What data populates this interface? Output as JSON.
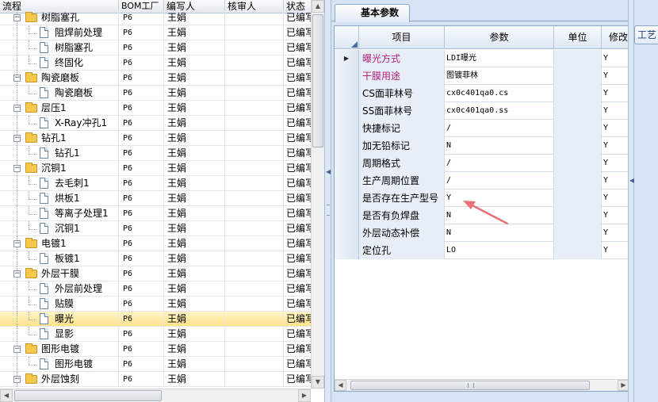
{
  "tree": {
    "headers": {
      "name": "流程",
      "plant": "BOM工厂",
      "writer": "编写人",
      "auditor": "核审人",
      "status": "状态"
    },
    "rows": [
      {
        "label": "树脂塞孔",
        "level": 1,
        "kind": "folder",
        "plant": "P6",
        "writer": "王娟",
        "status": "已编写"
      },
      {
        "label": "阻焊前处理",
        "level": 2,
        "kind": "doc",
        "plant": "P6",
        "writer": "王娟",
        "status": "已编写"
      },
      {
        "label": "树脂塞孔",
        "level": 2,
        "kind": "doc",
        "plant": "P6",
        "writer": "王娟",
        "status": "已编写"
      },
      {
        "label": "终固化",
        "level": 2,
        "kind": "doc",
        "plant": "P6",
        "writer": "王娟",
        "status": "已编写"
      },
      {
        "label": "陶瓷磨板",
        "level": 1,
        "kind": "folder",
        "plant": "P6",
        "writer": "王娟",
        "status": "已编写"
      },
      {
        "label": "陶瓷磨板",
        "level": 2,
        "kind": "doc",
        "plant": "P6",
        "writer": "王娟",
        "status": "已编写"
      },
      {
        "label": "层压1",
        "level": 1,
        "kind": "folder",
        "plant": "P6",
        "writer": "王娟",
        "status": "已编写"
      },
      {
        "label": "X-Ray冲孔1",
        "level": 2,
        "kind": "doc",
        "plant": "P6",
        "writer": "王娟",
        "status": "已编写"
      },
      {
        "label": "钻孔1",
        "level": 1,
        "kind": "folder",
        "plant": "P6",
        "writer": "王娟",
        "status": "已编写"
      },
      {
        "label": "钻孔1",
        "level": 2,
        "kind": "doc",
        "plant": "P6",
        "writer": "王娟",
        "status": "已编写"
      },
      {
        "label": "沉铜1",
        "level": 1,
        "kind": "folder",
        "plant": "P6",
        "writer": "王娟",
        "status": "已编写"
      },
      {
        "label": "去毛刺1",
        "level": 2,
        "kind": "doc",
        "plant": "P6",
        "writer": "王娟",
        "status": "已编写"
      },
      {
        "label": "烘板1",
        "level": 2,
        "kind": "doc",
        "plant": "P6",
        "writer": "王娟",
        "status": "已编写"
      },
      {
        "label": "等离子处理1",
        "level": 2,
        "kind": "doc",
        "plant": "P6",
        "writer": "王娟",
        "status": "已编写"
      },
      {
        "label": "沉铜1",
        "level": 2,
        "kind": "doc",
        "plant": "P6",
        "writer": "王娟",
        "status": "已编写"
      },
      {
        "label": "电镀1",
        "level": 1,
        "kind": "folder",
        "plant": "P6",
        "writer": "王娟",
        "status": "已编写"
      },
      {
        "label": "板镀1",
        "level": 2,
        "kind": "doc",
        "plant": "P6",
        "writer": "王娟",
        "status": "已编写"
      },
      {
        "label": "外层干膜",
        "level": 1,
        "kind": "folder",
        "plant": "P6",
        "writer": "王娟",
        "status": "已编写"
      },
      {
        "label": "外层前处理",
        "level": 2,
        "kind": "doc",
        "plant": "P6",
        "writer": "王娟",
        "status": "已编写"
      },
      {
        "label": "贴膜",
        "level": 2,
        "kind": "doc",
        "plant": "P6",
        "writer": "王娟",
        "status": "已编写"
      },
      {
        "label": "曝光",
        "level": 2,
        "kind": "doc",
        "plant": "P6",
        "writer": "王娟",
        "status": "已编写",
        "selected": true
      },
      {
        "label": "显影",
        "level": 2,
        "kind": "doc",
        "plant": "P6",
        "writer": "王娟",
        "status": "已编写"
      },
      {
        "label": "图形电镀",
        "level": 1,
        "kind": "folder",
        "plant": "P6",
        "writer": "王娟",
        "status": "已编写"
      },
      {
        "label": "图形电镀",
        "level": 2,
        "kind": "doc",
        "plant": "P6",
        "writer": "王娟",
        "status": "已编写"
      },
      {
        "label": "外层蚀刻",
        "level": 1,
        "kind": "folder",
        "plant": "P6",
        "writer": "王娟",
        "status": "已编写"
      }
    ]
  },
  "panel": {
    "tab_basic": "基本参数",
    "tab_craft": "工艺",
    "headers": {
      "item": "项目",
      "param": "参数",
      "unit": "单位",
      "mod": "修改"
    },
    "rows": [
      {
        "item": "曝光方式",
        "param": "LDI曝光",
        "unit": "",
        "mod": "Y",
        "highlight": true,
        "current": true
      },
      {
        "item": "干膜用途",
        "param": "图镀菲林",
        "unit": "",
        "mod": "Y",
        "highlight": true
      },
      {
        "item": "CS面菲林号",
        "param": "cx0c401qa0.cs",
        "unit": "",
        "mod": "Y"
      },
      {
        "item": "SS面菲林号",
        "param": "cx0c401qa0.ss",
        "unit": "",
        "mod": "Y"
      },
      {
        "item": "快捷标记",
        "param": "/",
        "unit": "",
        "mod": "Y"
      },
      {
        "item": "加无铅标记",
        "param": "N",
        "unit": "",
        "mod": "Y"
      },
      {
        "item": "周期格式",
        "param": "/",
        "unit": "",
        "mod": "Y"
      },
      {
        "item": "生产周期位置",
        "param": "/",
        "unit": "",
        "mod": "Y"
      },
      {
        "item": "是否存在生产型号",
        "param": "Y",
        "unit": "",
        "mod": "Y"
      },
      {
        "item": "是否有负焊盘",
        "param": "N",
        "unit": "",
        "mod": "Y"
      },
      {
        "item": "外层动态补偿",
        "param": "N",
        "unit": "",
        "mod": "Y"
      },
      {
        "item": "定位孔",
        "param": "LO",
        "unit": "",
        "mod": "Y"
      }
    ]
  },
  "colors": {
    "highlight_text": "#b3227f",
    "selection": "#ffe38a",
    "annotation_arrow": "#e8707a"
  },
  "icons": {
    "folder": "folder-icon",
    "doc": "document-icon",
    "row_pointer": "row-pointer-icon"
  }
}
